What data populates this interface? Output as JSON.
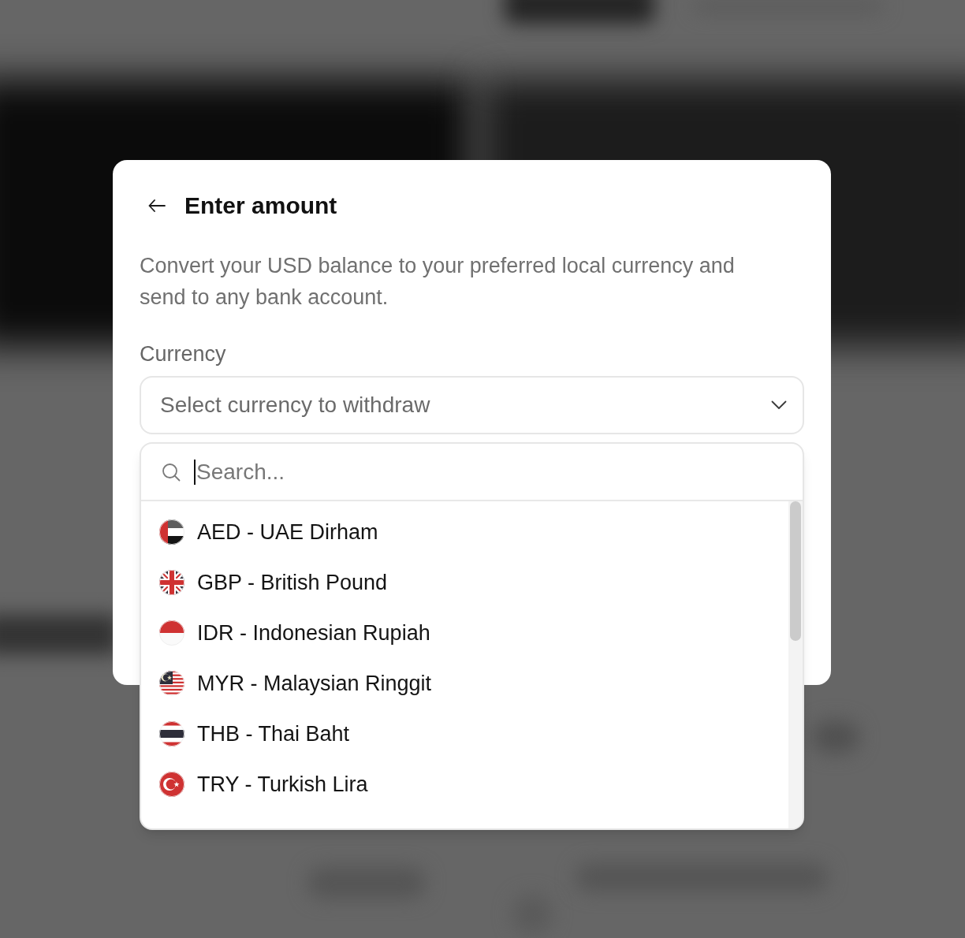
{
  "dialog": {
    "title": "Enter amount",
    "description": "Convert your USD balance to your preferred local currency and send to any bank account."
  },
  "currency_field": {
    "label": "Currency",
    "placeholder": "Select currency to withdraw",
    "expanded": true
  },
  "dropdown": {
    "search": {
      "placeholder": "Search...",
      "focused": true
    },
    "options": [
      {
        "label": "AED - UAE Dirham",
        "kind": "uae",
        "selected": false
      },
      {
        "label": "GBP - British Pound",
        "kind": "uk",
        "selected": false
      },
      {
        "label": "IDR - Indonesian Rupiah",
        "kind": "indonesia",
        "selected": false
      },
      {
        "label": "MYR - Malaysian Ringgit",
        "kind": "malaysia",
        "selected": false
      },
      {
        "label": "THB - Thai Baht",
        "kind": "thailand",
        "selected": false
      },
      {
        "label": "TRY - Turkish Lira",
        "kind": "turkey",
        "selected": false
      }
    ]
  }
}
